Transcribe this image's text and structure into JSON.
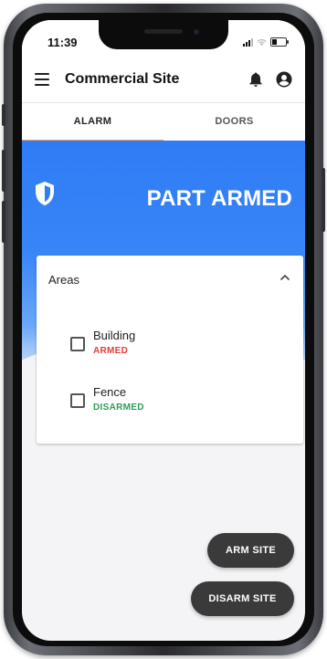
{
  "status_bar": {
    "time": "11:39"
  },
  "app_bar": {
    "title": "Commercial Site"
  },
  "tabs": [
    {
      "label": "ALARM",
      "active": true
    },
    {
      "label": "DOORS",
      "active": false
    }
  ],
  "hero": {
    "status": "PART ARMED",
    "icon": "shield-icon"
  },
  "areas_card": {
    "title": "Areas",
    "expanded": true,
    "items": [
      {
        "name": "Building",
        "state": "ARMED",
        "state_color": "#e53935",
        "checked": false
      },
      {
        "name": "Fence",
        "state": "DISARMED",
        "state_color": "#2e9b5a",
        "checked": false
      }
    ]
  },
  "actions": {
    "arm_label": "ARM SITE",
    "disarm_label": "DISARM SITE"
  },
  "colors": {
    "primary": "#2f7cf6",
    "tab_indicator": "#f0a868",
    "fab": "#3a3a3a"
  }
}
